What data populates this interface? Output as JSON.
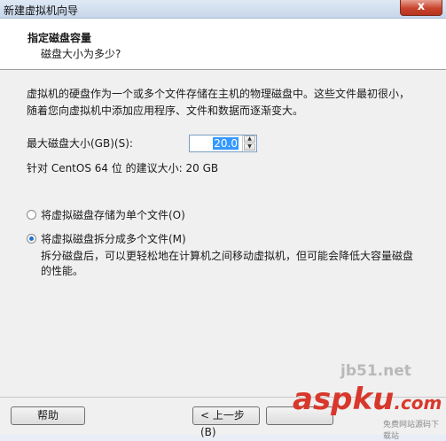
{
  "window": {
    "title": "新建虚拟机向导",
    "close_glyph": "x"
  },
  "header": {
    "title": "指定磁盘容量",
    "subtitle": "磁盘大小为多少?"
  },
  "description": "虚拟机的硬盘作为一个或多个文件存储在主机的物理磁盘中。这些文件最初很小，随着您向虚拟机中添加应用程序、文件和数据而逐渐变大。",
  "size_field": {
    "label": "最大磁盘大小(GB)(S):",
    "value": "20.0"
  },
  "recommended": "针对 CentOS 64 位 的建议大小: 20 GB",
  "radio_options": [
    {
      "label": "将虚拟磁盘存储为单个文件(O)",
      "checked": false
    },
    {
      "label": "将虚拟磁盘拆分成多个文件(M)",
      "checked": true
    }
  ],
  "note": "拆分磁盘后，可以更轻松地在计算机之间移动虚拟机，但可能会降低大容量磁盘的性能。",
  "buttons": {
    "help": "帮助",
    "back": "< 上一步(B)",
    "next": ""
  },
  "watermark": {
    "domain": "jb51.net",
    "brand": "aspku",
    "tld": ".com",
    "tagline": "免费网站源码下载站"
  }
}
